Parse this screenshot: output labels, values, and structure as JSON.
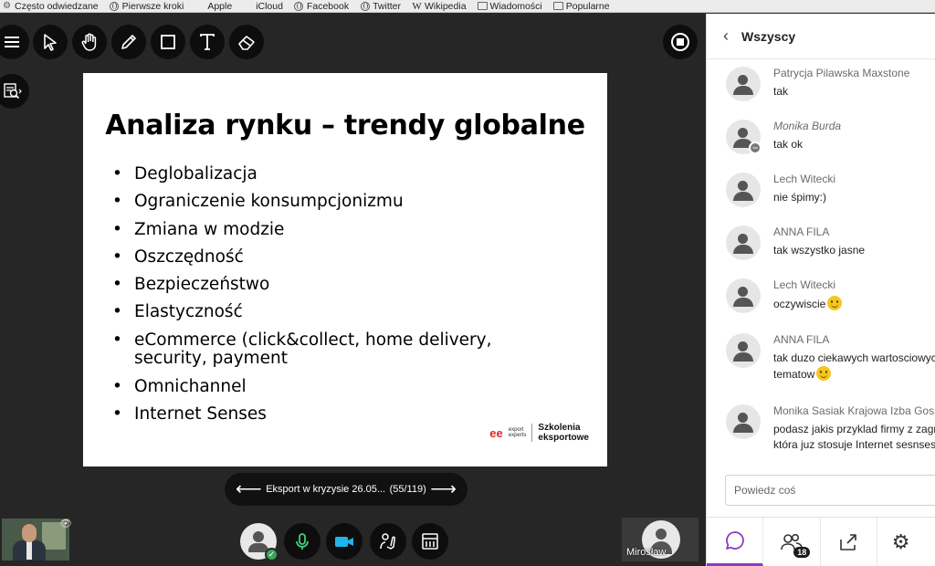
{
  "bookmarks": [
    {
      "label": "Często odwiedzane",
      "icon": "gear-icon"
    },
    {
      "label": "Pierwsze kroki",
      "icon": "globe-icon"
    },
    {
      "label": "Apple",
      "icon": "apple-icon"
    },
    {
      "label": "iCloud",
      "icon": "apple-icon"
    },
    {
      "label": "Facebook",
      "icon": "globe-icon"
    },
    {
      "label": "Twitter",
      "icon": "globe-icon"
    },
    {
      "label": "Wikipedia",
      "icon": "wikipedia-icon"
    },
    {
      "label": "Wiadomości",
      "icon": "folder-icon"
    },
    {
      "label": "Popularne",
      "icon": "folder-icon"
    }
  ],
  "slide": {
    "title": "Analiza rynku – trendy globalne",
    "bullets": [
      "Deglobalizacja",
      "Ograniczenie konsumpcjonizmu",
      "Zmiana w modzie",
      "Oszczędność",
      "Bezpieczeństwo",
      "Elastyczność",
      "eCommerce (click&collect, home delivery, security, payment",
      "Omnichannel",
      "Internet Senses"
    ],
    "logo_line1": "export",
    "logo_line2": "experts",
    "logo_brand_1": "Szkolenia",
    "logo_brand_2": "eksportowe"
  },
  "pager": {
    "document": "Eksport w kryzysie 26.05...",
    "position": "(55/119)"
  },
  "remote": {
    "name": "Mirosław"
  },
  "chat": {
    "header": "Wszyscy",
    "messages": [
      {
        "name": "Patrycja Pilawska Maxstone",
        "text": "tak"
      },
      {
        "name": "Monika Burda",
        "text": "tak ok"
      },
      {
        "name": "Lech Witecki",
        "text": "nie śpimy:)"
      },
      {
        "name": "ANNA FILA",
        "text": "tak wszystko jasne"
      },
      {
        "name": "Lech Witecki",
        "text": "oczywiscie"
      },
      {
        "name": "ANNA FILA",
        "text": "tak duzo ciekawych wartosciowych",
        "text2": "tematow"
      },
      {
        "name": "Monika Sasiak Krajowa Izba Gospodarcza",
        "text": "podasz jakis przyklad firmy z zagranicy",
        "text2": "która juz stosuje Internet sesnses?"
      }
    ],
    "input_placeholder": "Powiedz coś",
    "attendee_count": "18"
  },
  "colors": {
    "accent": "#8a3dc5",
    "stage_bg": "#262626",
    "mic_green": "#3fd07a",
    "camera_blue": "#1fb5ea"
  }
}
